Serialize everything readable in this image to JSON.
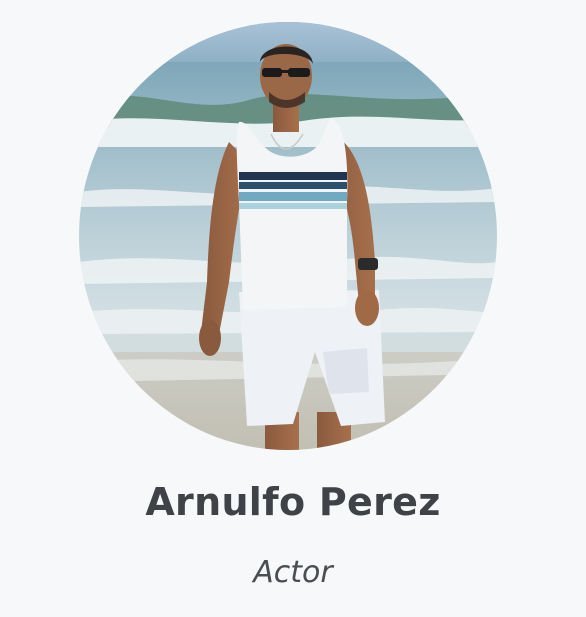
{
  "profile": {
    "name": "Arnulfo Perez",
    "role": "Actor",
    "photo_subject": "man-on-beach-photo"
  },
  "colors": {
    "background": "#f7f8fa",
    "name_text": "#3f4347",
    "role_text": "#4a4e52"
  }
}
